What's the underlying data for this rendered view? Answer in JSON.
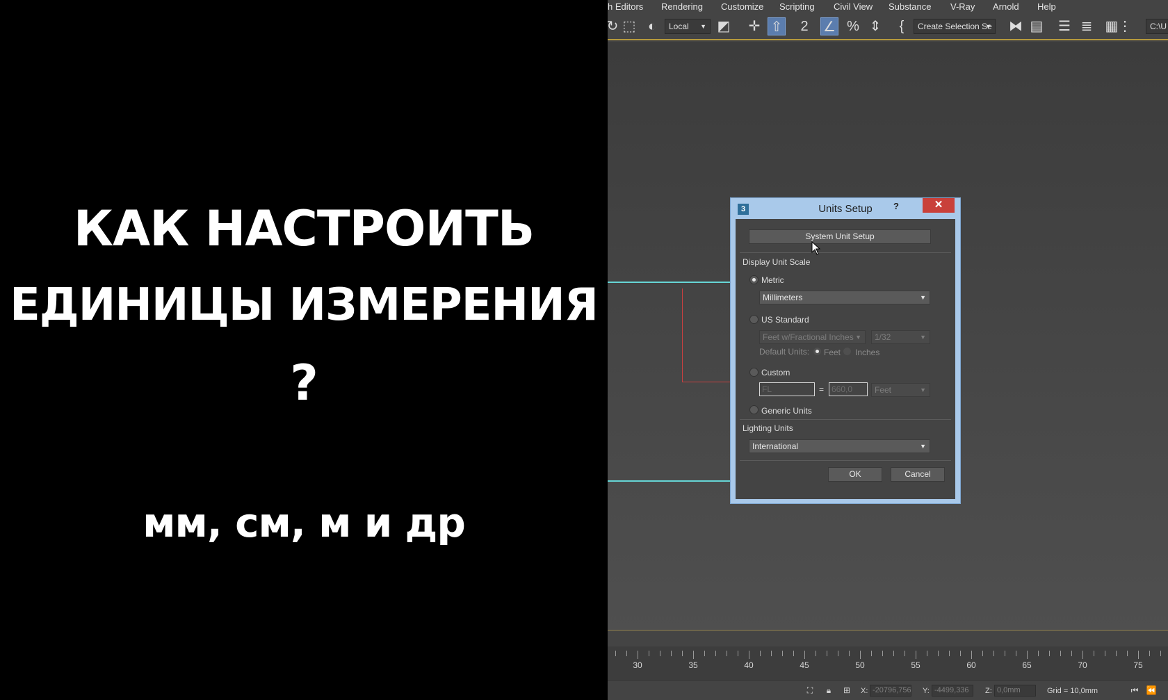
{
  "overlay": {
    "title_line1": "КАК НАСТРОИТЬ",
    "title_line2": "ЕДИНИЦЫ ИЗМЕРЕНИЯ",
    "title_line3": "?",
    "subtitle": "мм, см, м и др"
  },
  "menubar": {
    "items": [
      "h Editors",
      "Rendering",
      "Customize",
      "Scripting",
      "Civil View",
      "Substance",
      "V-Ray",
      "Arnold",
      "Help"
    ]
  },
  "toolbar": {
    "coord_system": "Local",
    "selection_set": "Create Selection Se",
    "path_text": "C:\\U"
  },
  "dialog": {
    "title": "Units Setup",
    "help_glyph": "?",
    "close_glyph": "✕",
    "system_unit_button": "System Unit Setup",
    "display_unit_scale_label": "Display Unit Scale",
    "metric_label": "Metric",
    "metric_value": "Millimeters",
    "us_standard_label": "US Standard",
    "us_units_value": "Feet w/Fractional Inches",
    "us_fraction_value": "1/32",
    "default_units_label": "Default Units:",
    "feet_label": "Feet",
    "inches_label": "Inches",
    "custom_label": "Custom",
    "custom_name_value": "FL",
    "equals_sign": "=",
    "custom_amount_value": "660,0",
    "custom_unit_value": "Feet",
    "generic_units_label": "Generic Units",
    "lighting_units_label": "Lighting Units",
    "lighting_units_value": "International",
    "ok_label": "OK",
    "cancel_label": "Cancel",
    "selected_unit_system": "Metric"
  },
  "timeline": {
    "labels": [
      "30",
      "35",
      "40",
      "45",
      "50",
      "55",
      "60",
      "65",
      "70",
      "75"
    ]
  },
  "statusbar": {
    "x_label": "X:",
    "x_value": "-20796,756",
    "y_label": "Y:",
    "y_value": "-4499,336",
    "z_label": "Z:",
    "z_value": "0,0mm",
    "grid_text": "Grid = 10,0mm"
  },
  "colors": {
    "accent_gold": "#b69a3d",
    "dialog_frame": "#a9c9ea",
    "close_red": "#c9403a",
    "viewport_cyan": "#66d6d6"
  }
}
